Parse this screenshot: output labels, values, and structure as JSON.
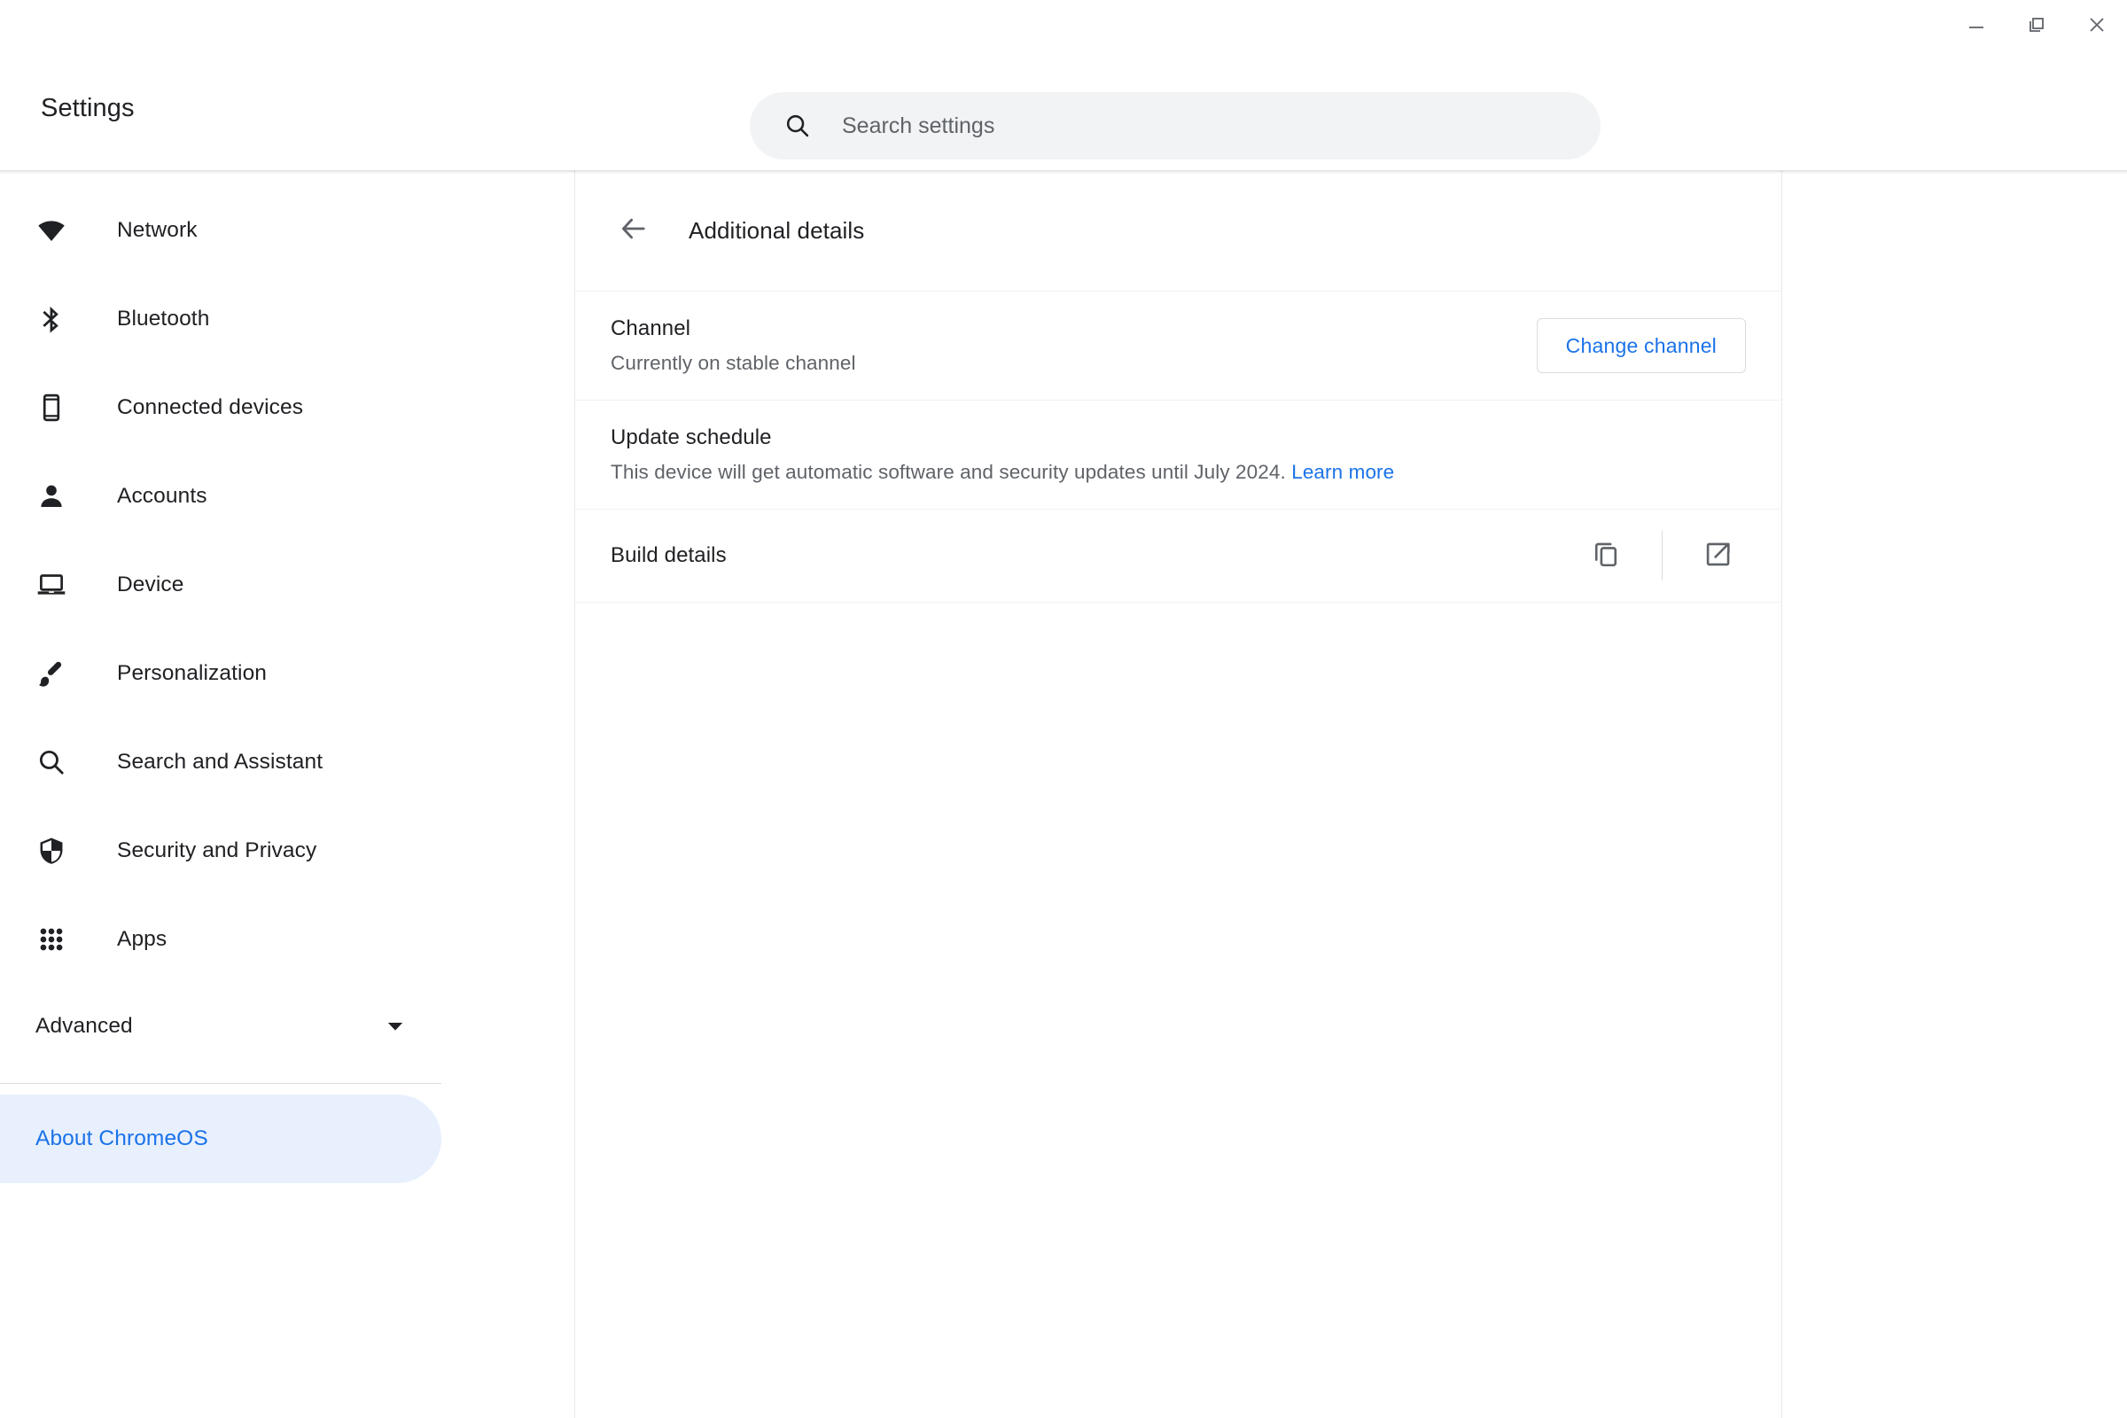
{
  "window": {
    "controls": [
      {
        "name": "minimize",
        "label": "Minimize"
      },
      {
        "name": "restore",
        "label": "Restore"
      },
      {
        "name": "close",
        "label": "Close"
      }
    ]
  },
  "header": {
    "title": "Settings",
    "search": {
      "placeholder": "Search settings",
      "value": "",
      "icon": "search-icon"
    }
  },
  "sidebar": {
    "items": [
      {
        "label": "Network",
        "icon": "wifi-icon"
      },
      {
        "label": "Bluetooth",
        "icon": "bluetooth-icon"
      },
      {
        "label": "Connected devices",
        "icon": "phone-icon"
      },
      {
        "label": "Accounts",
        "icon": "person-icon"
      },
      {
        "label": "Device",
        "icon": "laptop-icon"
      },
      {
        "label": "Personalization",
        "icon": "brush-icon"
      },
      {
        "label": "Search and Assistant",
        "icon": "search-icon"
      },
      {
        "label": "Security and Privacy",
        "icon": "shield-icon"
      },
      {
        "label": "Apps",
        "icon": "apps-grid-icon"
      }
    ],
    "advanced": {
      "label": "Advanced",
      "icon": "chevron-down-icon"
    },
    "about": {
      "label": "About ChromeOS",
      "selected": true
    }
  },
  "main": {
    "back_icon": "arrow-back-icon",
    "title": "Additional details",
    "rows": [
      {
        "id": "channel",
        "title": "Channel",
        "subtitle": "Currently on stable channel",
        "button": "Change channel"
      },
      {
        "id": "update-schedule",
        "title": "Update schedule",
        "subtitle": "This device will get automatic software and security updates until July 2024.",
        "link": "Learn more"
      },
      {
        "id": "build-details",
        "title": "Build details",
        "actions": [
          {
            "name": "copy-icon",
            "label": "Copy"
          },
          {
            "name": "open-in-new-icon",
            "label": "Open in new window"
          }
        ]
      }
    ]
  },
  "colors": {
    "accent": "#1a73e8",
    "selected_bg": "#e8f0fe",
    "text_primary": "#202124",
    "text_secondary": "#5f6368",
    "divider": "#dadce0",
    "search_bg": "#f1f3f4"
  }
}
